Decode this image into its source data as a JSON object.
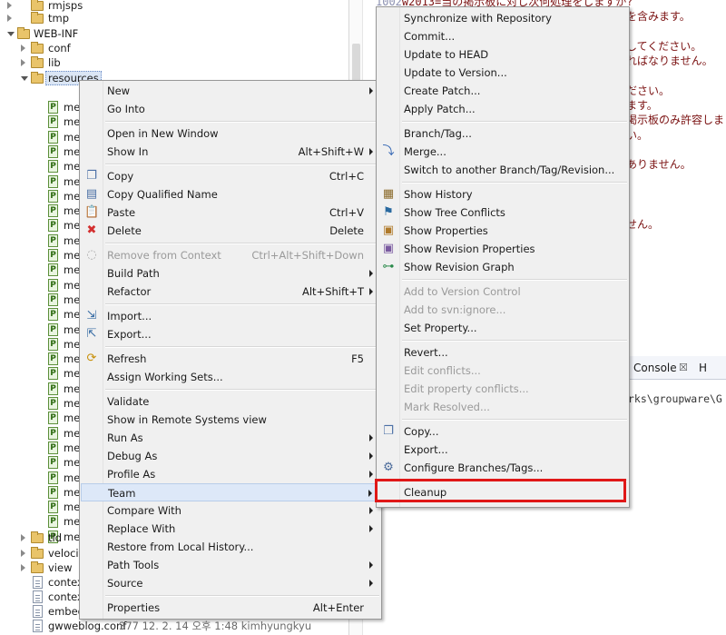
{
  "tree": {
    "folders": [
      {
        "label": "rmjsps",
        "state": "closed"
      },
      {
        "label": "tmp",
        "state": "closed"
      },
      {
        "label": "WEB-INF",
        "state": "open"
      },
      {
        "label": "conf",
        "state": "closed"
      },
      {
        "label": "lib",
        "state": "closed"
      },
      {
        "label": "resources",
        "state": "open"
      }
    ],
    "resource_item_label": "me",
    "bottom_items": [
      {
        "label": "tld",
        "kind": "folder"
      },
      {
        "label": "velocit",
        "kind": "folder"
      },
      {
        "label": "view",
        "kind": "folder"
      },
      {
        "label": "contex",
        "kind": "file"
      },
      {
        "label": "contex",
        "kind": "file"
      },
      {
        "label": "embed",
        "kind": "file"
      }
    ],
    "last_file": {
      "label": "gwweblog.conf",
      "decoration": "377  12. 2. 14 오후 1:48  kimhyungkyu"
    }
  },
  "editor": {
    "lines": [
      {
        "num": "1002",
        "text": "w2013=当の掲示板に対し次何処理をしますか?"
      },
      {
        "num": "",
        "text": "を含みます。"
      },
      {
        "num": "",
        "text": ""
      },
      {
        "num": "",
        "text": "してください。"
      },
      {
        "num": "",
        "text": "ればなりません。"
      },
      {
        "num": "",
        "text": ""
      },
      {
        "num": "",
        "text": "ださい。"
      },
      {
        "num": "",
        "text": "ます。"
      },
      {
        "num": "",
        "text": "掲示板のみ許容しま"
      },
      {
        "num": "",
        "text": "い。"
      },
      {
        "num": "",
        "text": ""
      },
      {
        "num": "",
        "text": "ありません。"
      },
      {
        "num": "",
        "text": ""
      },
      {
        "num": "",
        "text": ""
      },
      {
        "num": "",
        "text": ""
      },
      {
        "num": "",
        "text": "せん。"
      }
    ]
  },
  "console": {
    "tab_label": "Console",
    "close_glyph": "☒",
    "other_tab": "H",
    "text": "rks\\groupware\\G"
  },
  "context_menu": {
    "items": [
      {
        "label": "New",
        "shortcut": "",
        "submenu": true
      },
      {
        "label": "Go Into",
        "shortcut": ""
      },
      {
        "sep": true
      },
      {
        "label": "Open in New Window",
        "shortcut": ""
      },
      {
        "label": "Show In",
        "shortcut": "Alt+Shift+W",
        "submenu": true
      },
      {
        "sep": true
      },
      {
        "label": "Copy",
        "shortcut": "Ctrl+C",
        "icon": "copy-icon"
      },
      {
        "label": "Copy Qualified Name",
        "shortcut": "",
        "icon": "copy-qualified-name-icon"
      },
      {
        "label": "Paste",
        "shortcut": "Ctrl+V",
        "icon": "paste-icon"
      },
      {
        "label": "Delete",
        "shortcut": "Delete",
        "icon": "delete-icon"
      },
      {
        "sep": true
      },
      {
        "label": "Remove from Context",
        "shortcut": "Ctrl+Alt+Shift+Down",
        "disabled": true,
        "icon": "remove-context-icon"
      },
      {
        "label": "Build Path",
        "shortcut": "",
        "submenu": true
      },
      {
        "label": "Refactor",
        "shortcut": "Alt+Shift+T",
        "submenu": true
      },
      {
        "sep": true
      },
      {
        "label": "Import...",
        "shortcut": "",
        "icon": "import-icon"
      },
      {
        "label": "Export...",
        "shortcut": "",
        "icon": "export-icon"
      },
      {
        "sep": true
      },
      {
        "label": "Refresh",
        "shortcut": "F5",
        "icon": "refresh-icon"
      },
      {
        "label": "Assign Working Sets...",
        "shortcut": ""
      },
      {
        "sep": true
      },
      {
        "label": "Validate",
        "shortcut": ""
      },
      {
        "label": "Show in Remote Systems view",
        "shortcut": ""
      },
      {
        "label": "Run As",
        "shortcut": "",
        "submenu": true
      },
      {
        "label": "Debug As",
        "shortcut": "",
        "submenu": true
      },
      {
        "label": "Profile As",
        "shortcut": "",
        "submenu": true
      },
      {
        "label": "Team",
        "shortcut": "",
        "submenu": true,
        "highlighted": true
      },
      {
        "label": "Compare With",
        "shortcut": "",
        "submenu": true
      },
      {
        "label": "Replace With",
        "shortcut": "",
        "submenu": true
      },
      {
        "label": "Restore from Local History...",
        "shortcut": ""
      },
      {
        "label": "Path Tools",
        "shortcut": "",
        "submenu": true
      },
      {
        "label": "Source",
        "shortcut": "",
        "submenu": true
      },
      {
        "sep": true
      },
      {
        "label": "Properties",
        "shortcut": "Alt+Enter"
      }
    ]
  },
  "team_menu": {
    "items": [
      {
        "label": "Synchronize with Repository"
      },
      {
        "label": "Commit..."
      },
      {
        "label": "Update to HEAD"
      },
      {
        "label": "Update to Version..."
      },
      {
        "label": "Create Patch..."
      },
      {
        "label": "Apply Patch..."
      },
      {
        "sep": true
      },
      {
        "label": "Branch/Tag..."
      },
      {
        "label": "Merge...",
        "icon": "merge-icon"
      },
      {
        "label": "Switch to another Branch/Tag/Revision..."
      },
      {
        "sep": true
      },
      {
        "label": "Show History",
        "icon": "history-icon"
      },
      {
        "label": "Show Tree Conflicts",
        "icon": "tree-conflicts-icon"
      },
      {
        "label": "Show Properties",
        "icon": "properties-icon"
      },
      {
        "label": "Show Revision Properties",
        "icon": "revision-properties-icon"
      },
      {
        "label": "Show Revision Graph",
        "icon": "revision-graph-icon"
      },
      {
        "sep": true
      },
      {
        "label": "Add to Version Control",
        "disabled": true
      },
      {
        "label": "Add to svn:ignore...",
        "disabled": true
      },
      {
        "label": "Set Property..."
      },
      {
        "sep": true
      },
      {
        "label": "Revert..."
      },
      {
        "label": "Edit conflicts...",
        "disabled": true
      },
      {
        "label": "Edit property conflicts...",
        "disabled": true
      },
      {
        "label": "Mark Resolved...",
        "disabled": true
      },
      {
        "sep": true
      },
      {
        "label": "Copy...",
        "icon": "copy-icon"
      },
      {
        "label": "Export..."
      },
      {
        "label": "Configure Branches/Tags...",
        "icon": "configure-icon"
      },
      {
        "sep": true
      },
      {
        "label": "Cleanup",
        "emphasized": true
      }
    ]
  },
  "colors": {
    "highlight_box": "#e01818",
    "menu_bg": "#f0f0f0",
    "editor_text": "#7a1010"
  }
}
